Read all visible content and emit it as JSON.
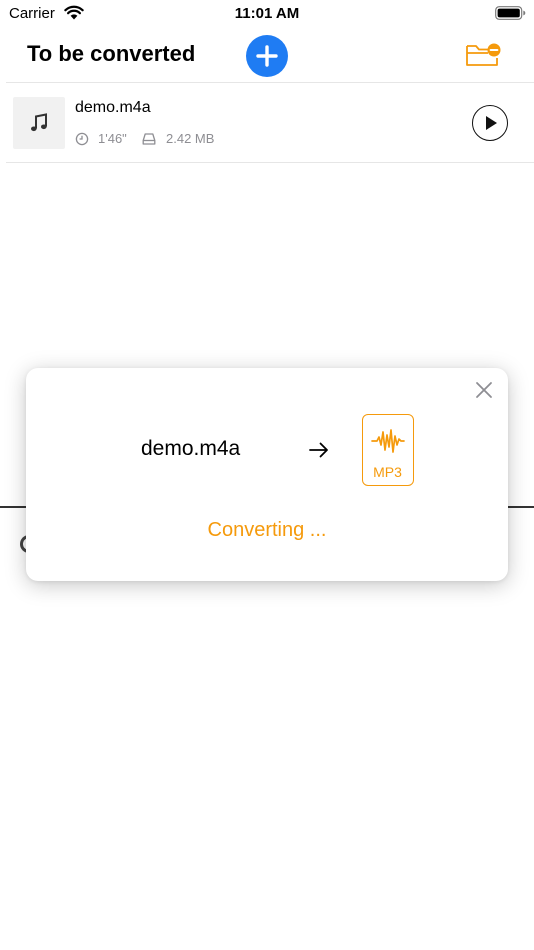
{
  "status_bar": {
    "carrier": "Carrier",
    "time": "11:01 AM"
  },
  "header": {
    "title": "To be converted",
    "add_icon": "plus-icon",
    "folder_icon": "folder-remove-icon",
    "accent_color": "#1f7cf3",
    "folder_color": "#f59a0c"
  },
  "files": [
    {
      "name": "demo.m4a",
      "duration": "1'46\"",
      "size": "2.42 MB",
      "thumb_icon": "music-note-icon",
      "action_icon": "play-icon"
    }
  ],
  "dialog": {
    "source_name": "demo.m4a",
    "target_format": "MP3",
    "status": "Converting ...",
    "accent_color": "#f59a0c",
    "close_icon": "close-icon",
    "arrow_icon": "arrow-right-icon"
  }
}
